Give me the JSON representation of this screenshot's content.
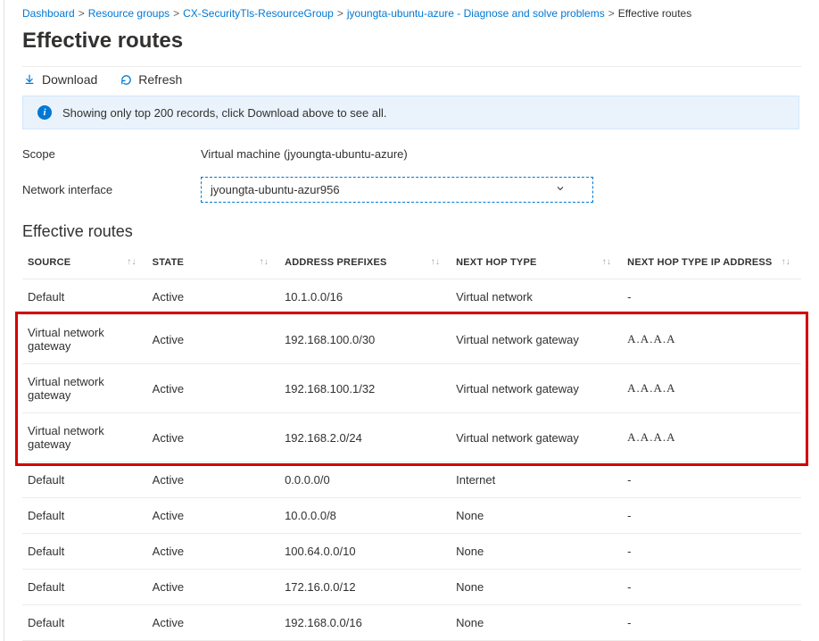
{
  "breadcrumb": {
    "items": [
      {
        "label": "Dashboard",
        "link": true
      },
      {
        "label": "Resource groups",
        "link": true
      },
      {
        "label": "CX-SecurityTls-ResourceGroup",
        "link": true
      },
      {
        "label": "jyoungta-ubuntu-azure - Diagnose and solve problems",
        "link": true
      },
      {
        "label": "Effective routes",
        "link": false
      }
    ]
  },
  "title": "Effective routes",
  "toolbar": {
    "download_label": "Download",
    "refresh_label": "Refresh"
  },
  "banner": {
    "text": "Showing only top 200 records, click Download above to see all."
  },
  "form": {
    "scope_label": "Scope",
    "scope_value": "Virtual machine (jyoungta-ubuntu-azure)",
    "nif_label": "Network interface",
    "nif_value": "jyoungta-ubuntu-azur956"
  },
  "section_title": "Effective routes",
  "columns": {
    "source": "Source",
    "state": "State",
    "prefix": "Address Prefixes",
    "nexthop": "Next Hop Type",
    "ip": "Next Hop Type IP Address"
  },
  "rows": [
    {
      "source": "Default",
      "state": "Active",
      "prefix": "10.1.0.0/16",
      "nexthop": "Virtual network",
      "ip": "-",
      "highlight": false
    },
    {
      "source": "Virtual network gateway",
      "state": "Active",
      "prefix": "192.168.100.0/30",
      "nexthop": "Virtual network gateway",
      "ip": "A.A.A.A",
      "highlight": true
    },
    {
      "source": "Virtual network gateway",
      "state": "Active",
      "prefix": "192.168.100.1/32",
      "nexthop": "Virtual network gateway",
      "ip": "A.A.A.A",
      "highlight": true
    },
    {
      "source": "Virtual network gateway",
      "state": "Active",
      "prefix": "192.168.2.0/24",
      "nexthop": "Virtual network gateway",
      "ip": "A.A.A.A",
      "highlight": true
    },
    {
      "source": "Default",
      "state": "Active",
      "prefix": "0.0.0.0/0",
      "nexthop": "Internet",
      "ip": "-",
      "highlight": false
    },
    {
      "source": "Default",
      "state": "Active",
      "prefix": "10.0.0.0/8",
      "nexthop": "None",
      "ip": "-",
      "highlight": false
    },
    {
      "source": "Default",
      "state": "Active",
      "prefix": "100.64.0.0/10",
      "nexthop": "None",
      "ip": "-",
      "highlight": false
    },
    {
      "source": "Default",
      "state": "Active",
      "prefix": "172.16.0.0/12",
      "nexthop": "None",
      "ip": "-",
      "highlight": false
    },
    {
      "source": "Default",
      "state": "Active",
      "prefix": "192.168.0.0/16",
      "nexthop": "None",
      "ip": "-",
      "highlight": false
    }
  ]
}
